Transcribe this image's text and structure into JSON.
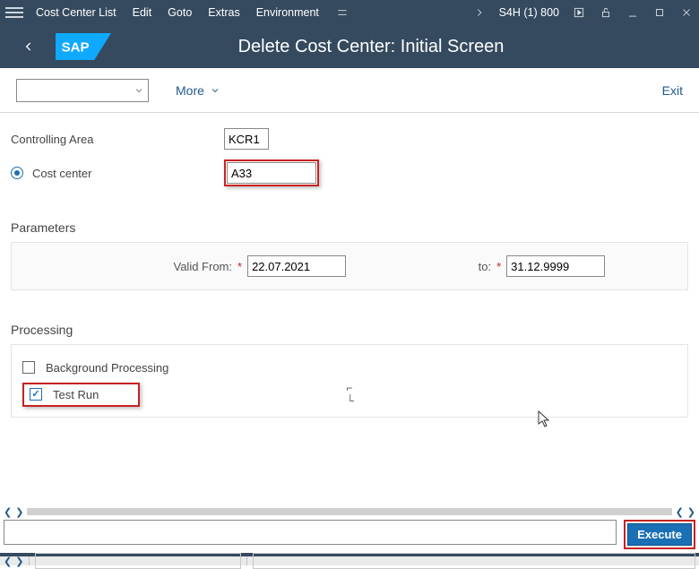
{
  "menubar": {
    "items": [
      "Cost Center List",
      "Edit",
      "Goto",
      "Extras",
      "Environment"
    ],
    "session": "S4H (1) 800"
  },
  "header": {
    "title": "Delete Cost Center: Initial Screen",
    "logo_text": "SAP"
  },
  "toolbar": {
    "more": "More",
    "exit": "Exit"
  },
  "fields": {
    "controlling_area_label": "Controlling Area",
    "controlling_area_value": "KCR1",
    "cost_center_label": "Cost center",
    "cost_center_value": "A33"
  },
  "parameters": {
    "heading": "Parameters",
    "valid_from_label": "Valid From:",
    "valid_from_value": "22.07.2021",
    "to_label": "to:",
    "to_value": "31.12.9999"
  },
  "processing": {
    "heading": "Processing",
    "background_label": "Background Processing",
    "background_checked": false,
    "testrun_label": "Test Run",
    "testrun_checked": true
  },
  "footer": {
    "execute": "Execute"
  }
}
